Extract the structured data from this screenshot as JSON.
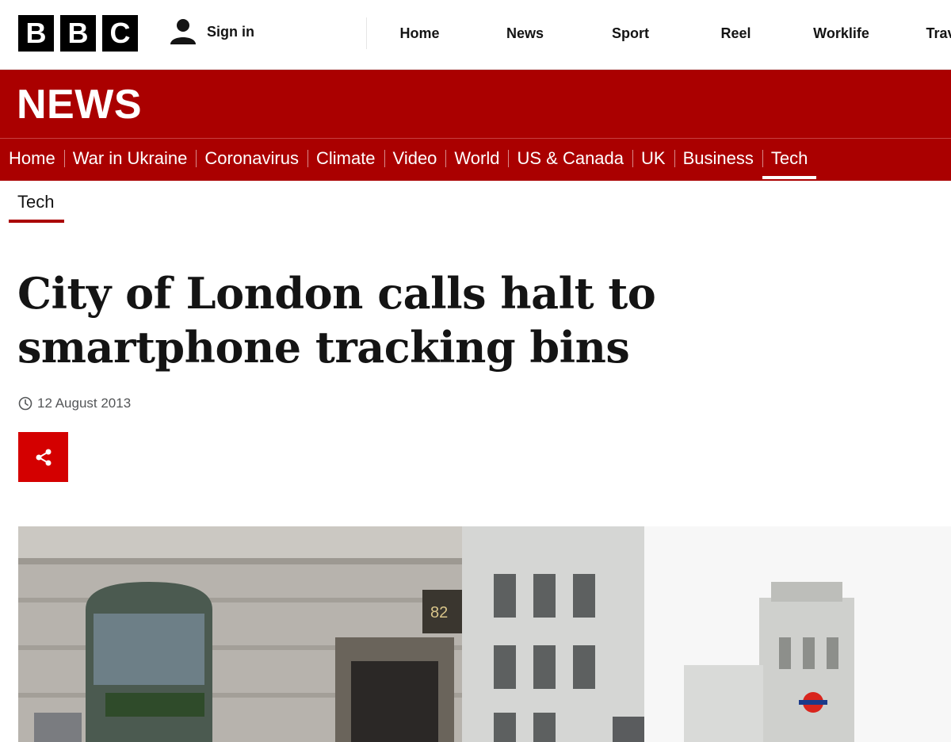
{
  "masthead": {
    "logo_letters": [
      "B",
      "B",
      "C"
    ],
    "signin_label": "Sign in",
    "nav": [
      "Home",
      "News",
      "Sport",
      "Reel",
      "Worklife",
      "Travel"
    ]
  },
  "news": {
    "title": "NEWS",
    "subnav": [
      "Home",
      "War in Ukraine",
      "Coronavirus",
      "Climate",
      "Video",
      "World",
      "US & Canada",
      "UK",
      "Business",
      "Tech"
    ],
    "active": "Tech"
  },
  "secondary_nav": {
    "item": "Tech"
  },
  "article": {
    "headline": "City of London calls halt to smartphone tracking bins",
    "date": "12 August 2013"
  },
  "colors": {
    "brand_red": "#aa0000",
    "share_red": "#d40000"
  },
  "icons": [
    "user-icon",
    "clock-icon",
    "share-icon"
  ]
}
